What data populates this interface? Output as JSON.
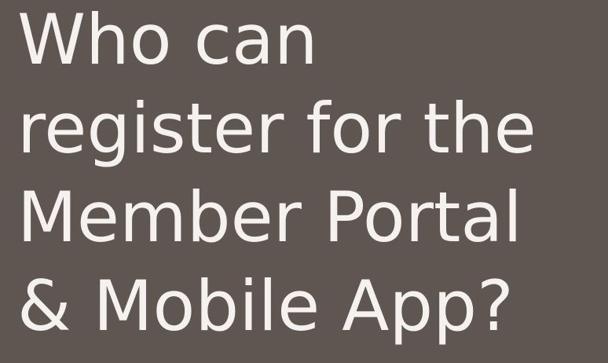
{
  "heading": {
    "lines": [
      "Who can",
      "register for the",
      "Member Portal",
      "& Mobile App?"
    ]
  },
  "colors": {
    "background": "#5f5551",
    "text": "#f4f1ee"
  }
}
